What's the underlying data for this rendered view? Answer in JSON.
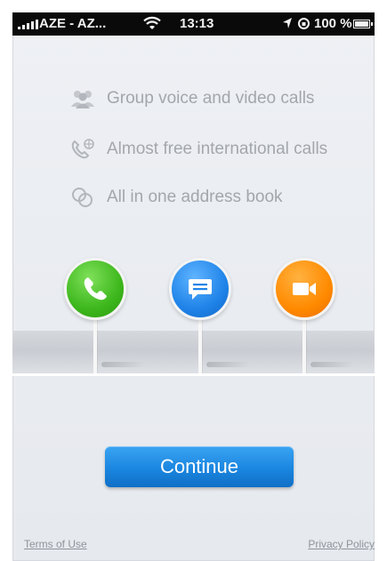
{
  "status_bar": {
    "carrier": "AZE - AZ...",
    "time": "13:13",
    "battery_percent": "100 %",
    "icons": [
      "signal-icon",
      "wifi-icon",
      "location-arrow-icon",
      "rotation-lock-icon",
      "battery-icon"
    ]
  },
  "features": [
    {
      "icon": "group-icon",
      "label": "Group voice and video calls"
    },
    {
      "icon": "globe-phone-icon",
      "label": "Almost free international calls"
    },
    {
      "icon": "address-book-icon",
      "label": "All in one address book"
    }
  ],
  "pins": [
    {
      "icon": "phone-icon",
      "color": "#3db71c"
    },
    {
      "icon": "chat-icon",
      "color": "#1f83e8"
    },
    {
      "icon": "video-camera-icon",
      "color": "#ff8a00"
    }
  ],
  "continue_label": "Continue",
  "footer": {
    "terms": "Terms of Use",
    "privacy": "Privacy Policy"
  },
  "colors": {
    "accent": "#1b86e0",
    "feature_text": "#a3a6ab",
    "status_bar": "#0a0a0a"
  }
}
